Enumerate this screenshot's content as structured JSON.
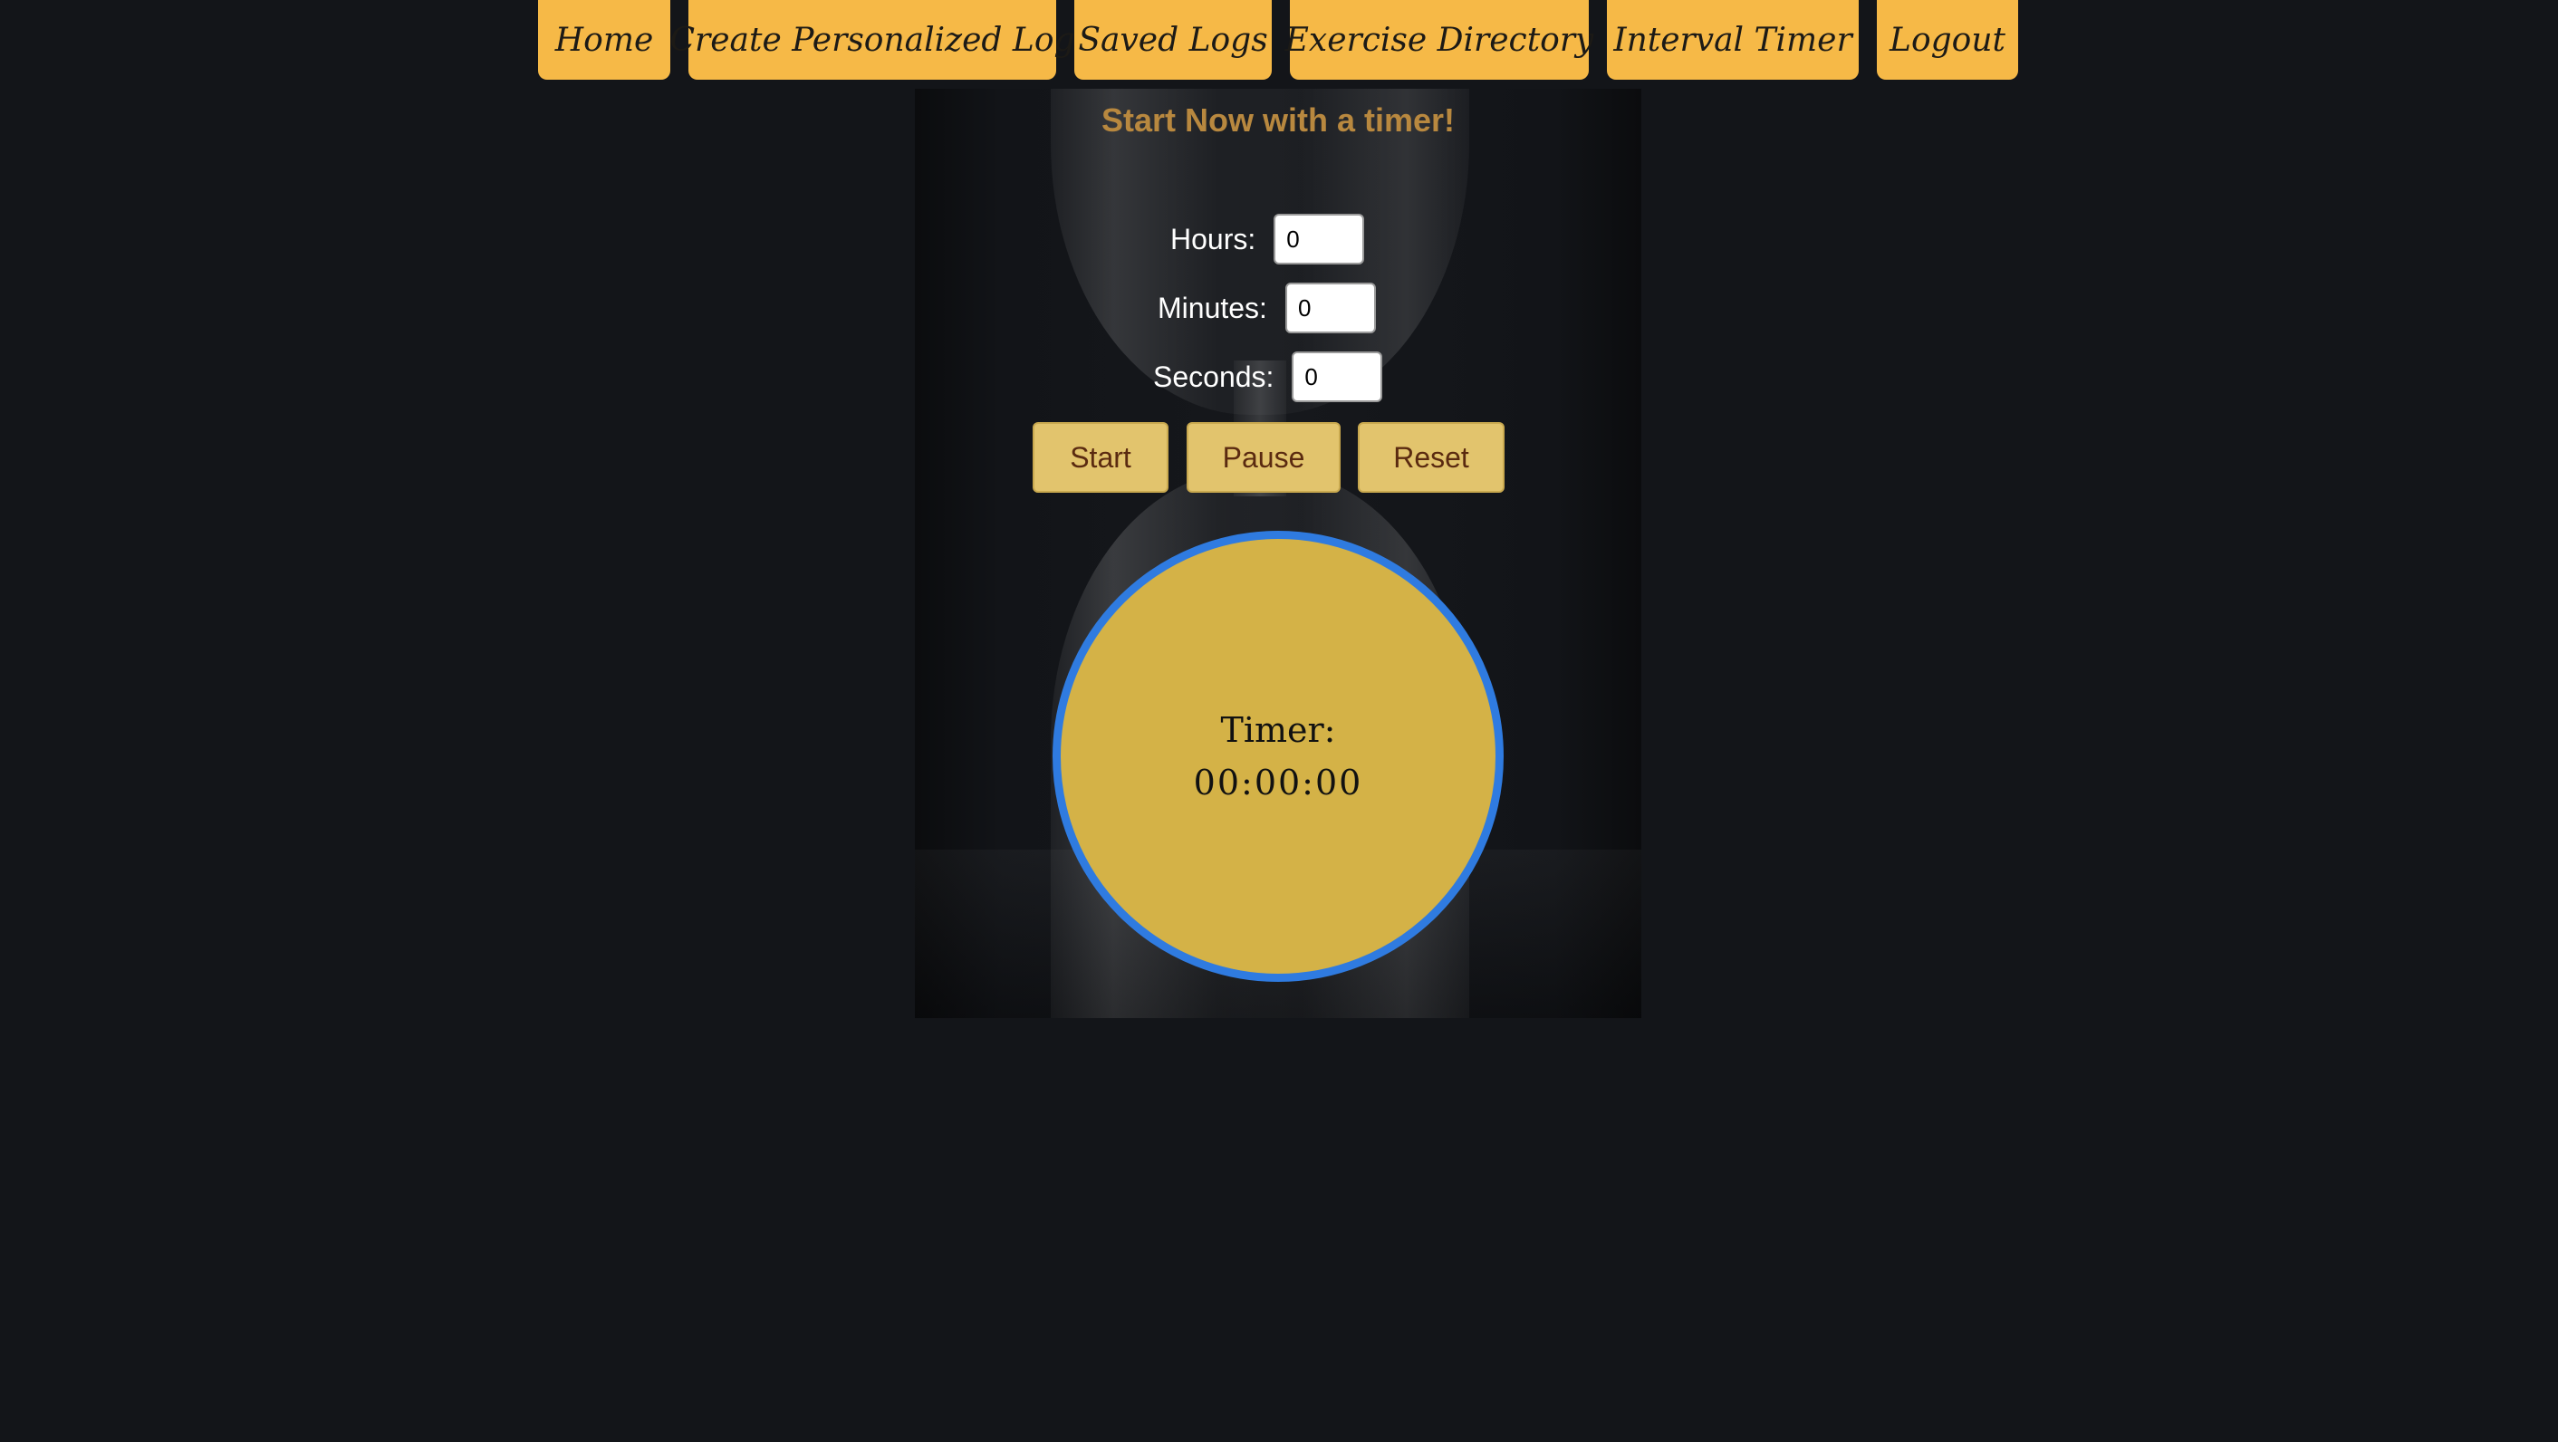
{
  "nav": {
    "home": "Home",
    "create_log": "Create Personalized Log",
    "saved_logs": "Saved Logs",
    "exercise_directory": "Exercise Directory",
    "interval_timer": "Interval Timer",
    "logout": "Logout"
  },
  "hero": {
    "title": "Start Now with a timer!"
  },
  "fields": {
    "hours_label": "Hours:",
    "hours_value": "0",
    "minutes_label": "Minutes:",
    "minutes_value": "0",
    "seconds_label": "Seconds:",
    "seconds_value": "0"
  },
  "controls": {
    "start": "Start",
    "pause": "Pause",
    "reset": "Reset"
  },
  "timer": {
    "label": "Timer:",
    "value": "00:00:00"
  },
  "colors": {
    "nav_bg": "#f6b947",
    "page_bg": "#131519",
    "title": "#b8883f",
    "button_bg": "#e2c46d",
    "button_text": "#5a2a10",
    "timer_fill": "#d4b247",
    "timer_ring": "#2f7be0"
  }
}
